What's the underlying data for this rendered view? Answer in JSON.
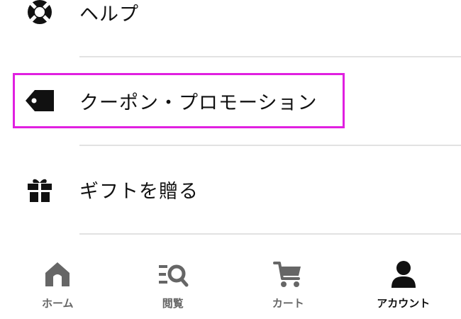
{
  "menu": {
    "items": [
      {
        "label": "ヘルプ",
        "icon": "lifebuoy-icon"
      },
      {
        "label": "クーポン・プロモーション",
        "icon": "tag-icon",
        "highlighted": true
      },
      {
        "label": "ギフトを贈る",
        "icon": "gift-icon"
      }
    ]
  },
  "tabbar": {
    "tabs": [
      {
        "label": "ホーム",
        "icon": "home-icon",
        "active": false
      },
      {
        "label": "閲覧",
        "icon": "browse-search-icon",
        "active": false
      },
      {
        "label": "カート",
        "icon": "cart-icon",
        "active": false
      },
      {
        "label": "アカウント",
        "icon": "account-icon",
        "active": true
      }
    ]
  },
  "colors": {
    "highlight": "#e020e0",
    "inactive_tab": "#666666",
    "active_tab": "#111111",
    "divider": "#e2e2e2"
  }
}
